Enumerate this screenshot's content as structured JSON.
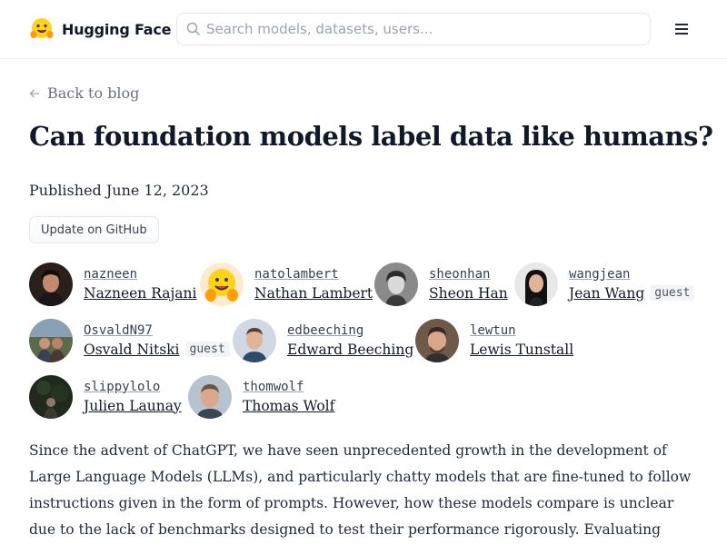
{
  "header": {
    "logo_text": "Hugging Face",
    "search_placeholder": "Search models, datasets, users..."
  },
  "article": {
    "back_label": "Back to blog",
    "title": "Can foundation models label data like humans?",
    "published_label": "Published",
    "published_date": "June 12, 2023",
    "github_button": "Update on GitHub",
    "body": "Since the advent of ChatGPT, we have seen unprecedented growth in the development of Large Language Models (LLMs), and particularly chatty models that are fine-tuned to follow instructions given in the form of prompts. However, how these models compare is unclear due to the lack of benchmarks designed to test their performance rigorously. Evaluating instruction and chatty models"
  },
  "authors": [
    {
      "username": "nazneen",
      "name": "Nazneen Rajani",
      "guest": ""
    },
    {
      "username": "natolambert",
      "name": "Nathan Lambert",
      "guest": ""
    },
    {
      "username": "sheonhan",
      "name": "Sheon Han",
      "guest": ""
    },
    {
      "username": "wangjean",
      "name": "Jean Wang",
      "guest": "guest"
    },
    {
      "username": "OsvaldN97",
      "name": "Osvald Nitski",
      "guest": "guest"
    },
    {
      "username": "edbeeching",
      "name": "Edward Beeching",
      "guest": ""
    },
    {
      "username": "lewtun",
      "name": "Lewis Tunstall",
      "guest": ""
    },
    {
      "username": "slippylolo",
      "name": "Julien Launay",
      "guest": ""
    },
    {
      "username": "thomwolf",
      "name": "Thomas Wolf",
      "guest": ""
    }
  ]
}
